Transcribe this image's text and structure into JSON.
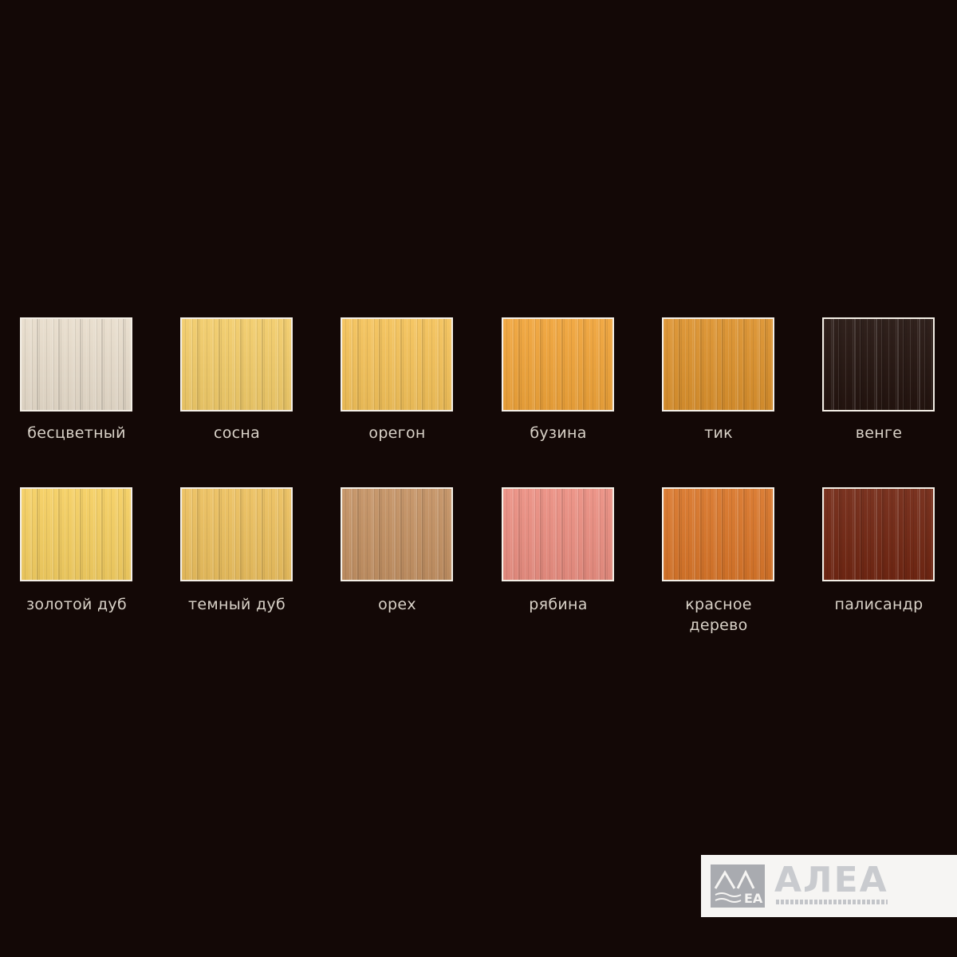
{
  "swatches": [
    {
      "label": "бесцветный",
      "color": "#e8ddcc"
    },
    {
      "label": "сосна",
      "color": "#f2cc6a"
    },
    {
      "label": "орегон",
      "color": "#f4c25a"
    },
    {
      "label": "бузина",
      "color": "#f0a43a"
    },
    {
      "label": "тик",
      "color": "#dc922e"
    },
    {
      "label": "венге",
      "color": "#24140f"
    },
    {
      "label": "золотой дуб",
      "color": "#f5cf62"
    },
    {
      "label": "темный дуб",
      "color": "#ecc05f"
    },
    {
      "label": "орех",
      "color": "#c49264"
    },
    {
      "label": "рябина",
      "color": "#eb8f82"
    },
    {
      "label": "красное\nдерево",
      "color": "#d9762a"
    },
    {
      "label": "палисандр",
      "color": "#722713"
    }
  ],
  "logo": {
    "text": "АЛЕА",
    "mark_text": "АЛЕА"
  },
  "colors": {
    "background": "#130806",
    "label": "#d9d2c8",
    "swatch_border": "#f4efe6"
  }
}
